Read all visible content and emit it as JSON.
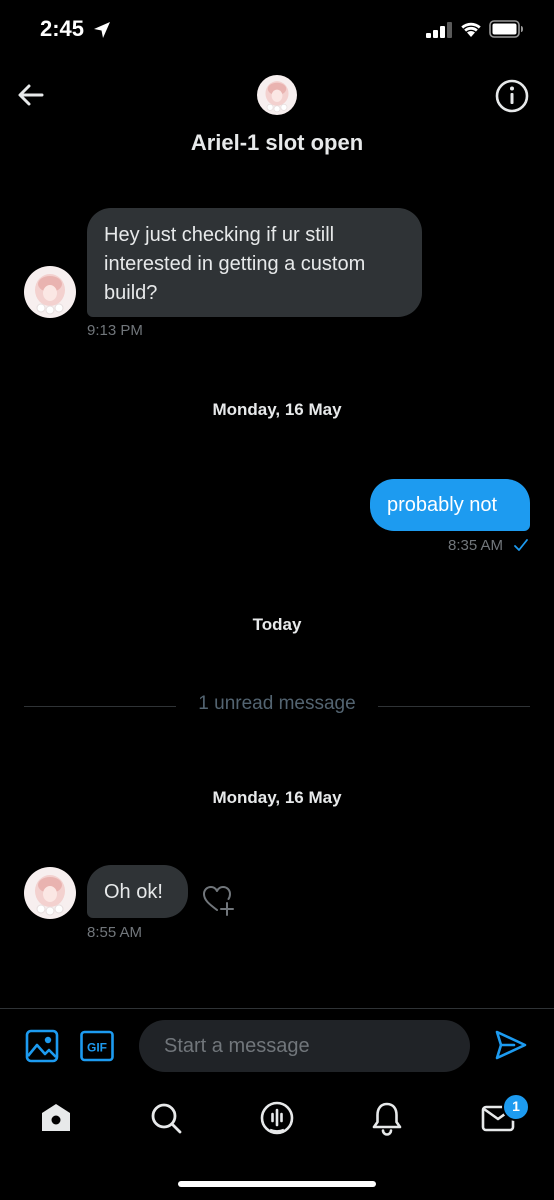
{
  "status_bar": {
    "time": "2:45"
  },
  "header": {
    "title": "Ariel-1 slot open"
  },
  "messages": [
    {
      "direction": "incoming",
      "text": "Hey just checking if ur still interested in getting a custom build?",
      "lines": [
        "Hey just checking if ur still",
        "interested in getting a custom",
        "build?"
      ],
      "time": "9:13 PM"
    },
    {
      "direction": "outgoing",
      "text": "probably not",
      "time": "8:35 AM",
      "read_receipt": "check-icon"
    },
    {
      "direction": "incoming",
      "text": "Oh ok!",
      "time": "8:55 AM"
    }
  ],
  "separators": {
    "date_1": "Monday, 16 May",
    "today": "Today",
    "unread": "1 unread message",
    "date_2": "Monday, 16 May"
  },
  "composer": {
    "placeholder": "Start a message",
    "gif_label": "GIF"
  },
  "tab_bar": {
    "items": [
      "home-icon",
      "search-icon",
      "spaces-icon",
      "notifications-icon",
      "messages-icon"
    ],
    "messages_badge": "1"
  },
  "colors": {
    "accent": "#1d9bf0",
    "background": "#000000",
    "incoming_bubble": "#2f3336",
    "secondary_text": "#71767b"
  }
}
